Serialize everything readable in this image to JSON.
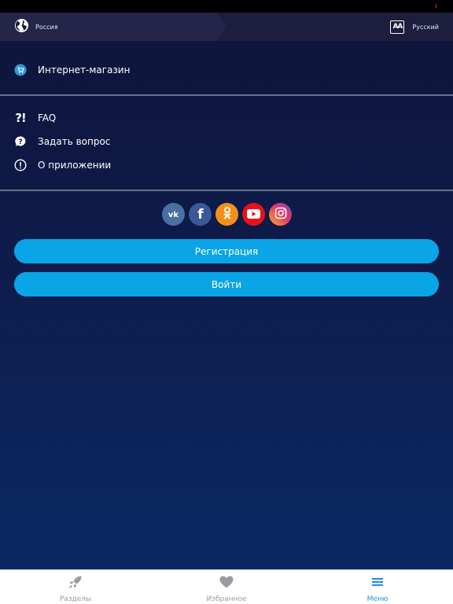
{
  "topbar": {
    "region": "Россия",
    "language": "Русский",
    "lang_icon_text": "AA"
  },
  "menu": {
    "shop": "Интернет-магазин",
    "faq": "FAQ",
    "ask": "Задать вопрос",
    "about": "О приложении",
    "faq_icon_text": "?!"
  },
  "socials": [
    {
      "name": "vk",
      "glyph": "vk",
      "color": "#4a6fa0"
    },
    {
      "name": "facebook",
      "glyph": "f",
      "color": "#3b5898"
    },
    {
      "name": "odnoklassniki",
      "glyph": "ok",
      "color": "#f49019"
    },
    {
      "name": "youtube",
      "glyph": "yt",
      "color": "#e8111a"
    },
    {
      "name": "instagram",
      "glyph": "ig",
      "color": "#d6336c"
    }
  ],
  "buttons": {
    "register": "Регистрация",
    "login": "Войти"
  },
  "tabs": [
    {
      "label": "Разделы",
      "icon": "rocket-icon",
      "active": false
    },
    {
      "label": "Избранное",
      "icon": "heart-icon",
      "active": false
    },
    {
      "label": "Меню",
      "icon": "hamburger-menu-icon",
      "active": true
    }
  ],
  "colors": {
    "accent": "#0aa5e6",
    "active_tab": "#1a8fe0",
    "bg_top": "#0f1438",
    "bg_bottom": "#0b2a66"
  }
}
